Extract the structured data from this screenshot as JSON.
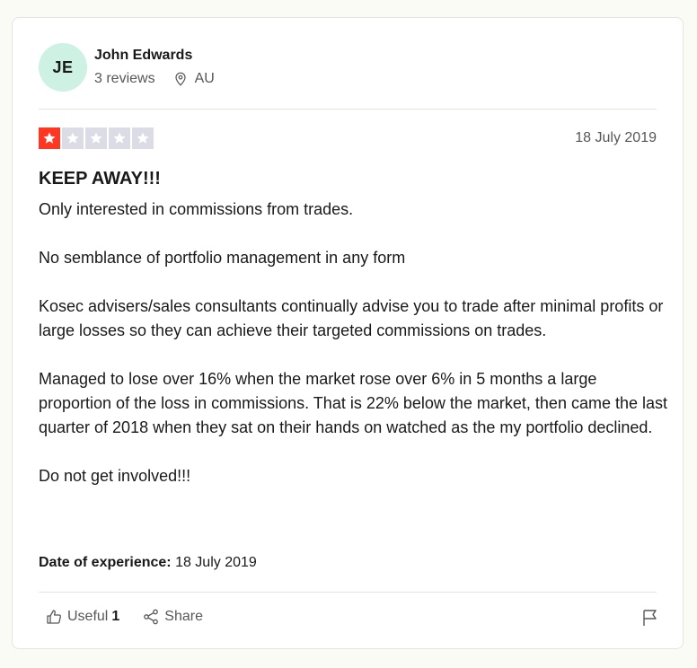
{
  "consumer": {
    "initials": "JE",
    "name": "John Edwards",
    "reviews": "3 reviews",
    "country": "AU"
  },
  "review": {
    "rating": 1,
    "max_rating": 5,
    "date": "18 July 2019",
    "title": "KEEP AWAY!!!",
    "paragraphs": [
      "Only interested in commissions from trades.",
      "No semblance of portfolio management in any form",
      "Kosec advisers/sales consultants continually advise you to trade after minimal profits or large losses so they can achieve their targeted commissions on trades.",
      "Managed to lose over 16% when the market rose over 6% in 5 months a large proportion of the loss in commissions. That is 22% below the market, then came the last quarter of 2018 when they sat on their hands on watched as the my portfolio declined.",
      "Do not get involved!!!"
    ],
    "experience_label": "Date of experience:",
    "experience_date": "18 July 2019"
  },
  "actions": {
    "useful_label": "Useful",
    "useful_count": "1",
    "share_label": "Share"
  },
  "colors": {
    "star_filled": "#ff3722",
    "star_empty": "#dcdce6",
    "avatar_bg": "#cdf1e2"
  },
  "icons": [
    "location-pin-icon",
    "star-icon",
    "thumbs-up-icon",
    "share-icon",
    "flag-icon"
  ]
}
